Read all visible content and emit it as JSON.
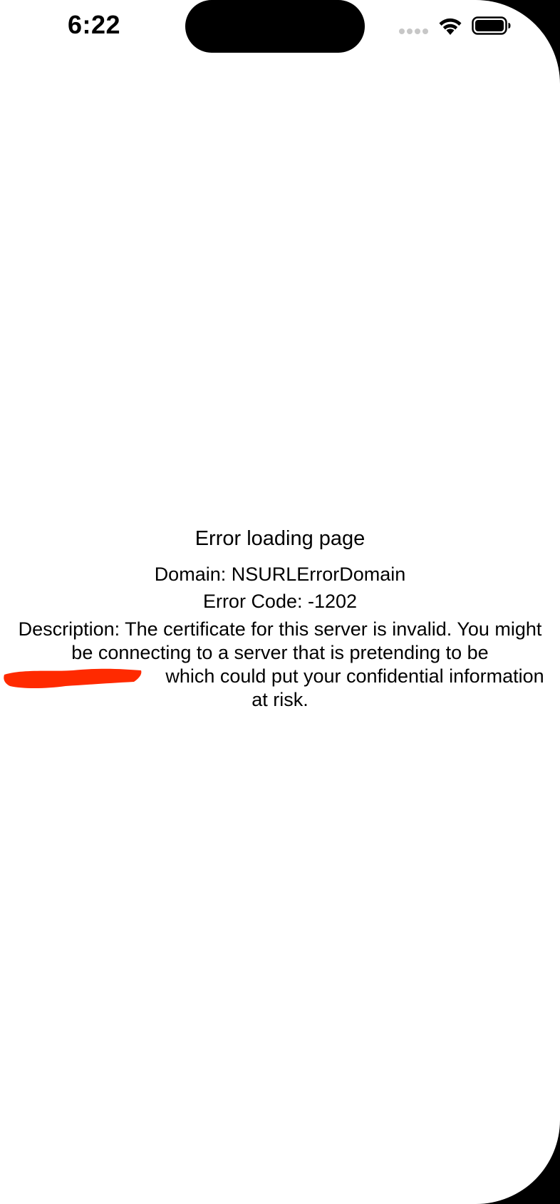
{
  "status_bar": {
    "time": "6:22",
    "icons": [
      "cellular-signal-icon",
      "wifi-icon",
      "battery-icon"
    ]
  },
  "error": {
    "title": "Error loading page",
    "domain_line": "Domain: NSURLErrorDomain",
    "code_line": "Error Code: -1202",
    "description_lines": [
      "Description: The certificate for this server is invalid. You might",
      "be connecting to a server that is pretending to be",
      "which could put your confidential information",
      "at risk."
    ]
  },
  "colors": {
    "background": "#ffffff",
    "text": "#000000",
    "redaction": "#ff2a00",
    "status_dots": "#c7c7c7"
  }
}
